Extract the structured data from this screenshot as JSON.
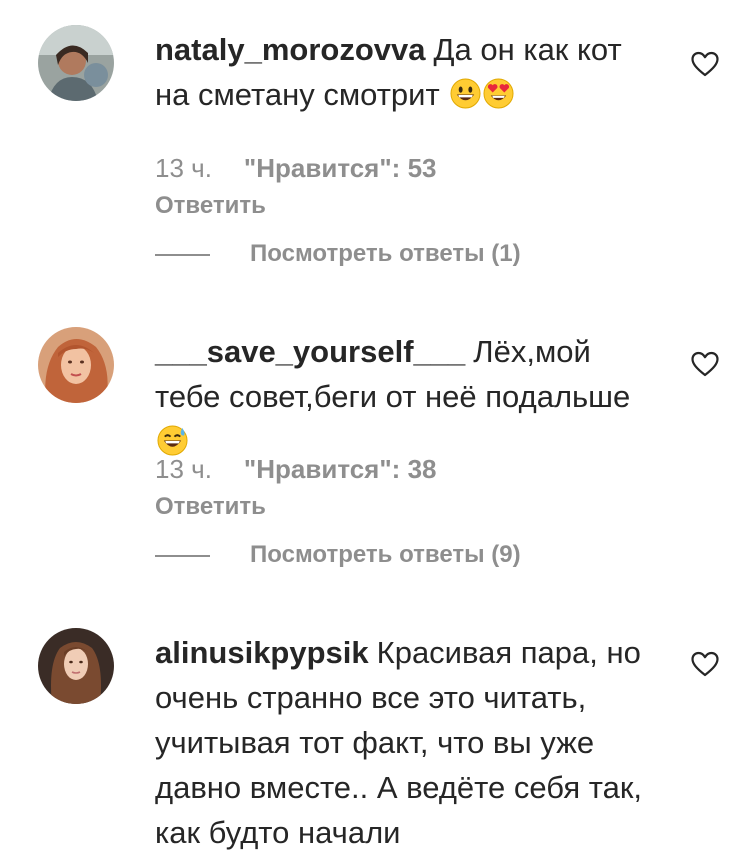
{
  "comments": [
    {
      "username": "nataly_morozovva",
      "text": "Да он как кот на сметану смотрит",
      "emojis": [
        "grinning-face",
        "heart-eyes-face"
      ],
      "time": "13 ч.",
      "likes": "\"Нравится\": 53",
      "reply_label": "Ответить",
      "view_replies": "Посмотреть ответы (1)"
    },
    {
      "username": "___save_yourself___",
      "text": "Лёх,мой тебе совет,беги от неё подальше",
      "emojis": [
        "grinning-sweat-face"
      ],
      "time": "13 ч.",
      "likes": "\"Нравится\": 38",
      "reply_label": "Ответить",
      "view_replies": "Посмотреть ответы (9)"
    },
    {
      "username": "alinusikpypsik",
      "text": "Красивая пара, но очень странно все это читать, учитывая тот факт, что вы уже давно вместе.. А ведёте себя так, как будто начали"
    }
  ],
  "icons": {
    "like": "heart-outline-icon"
  },
  "colors": {
    "text": "#262626",
    "secondary": "#8e8e8e",
    "background": "#ffffff"
  }
}
